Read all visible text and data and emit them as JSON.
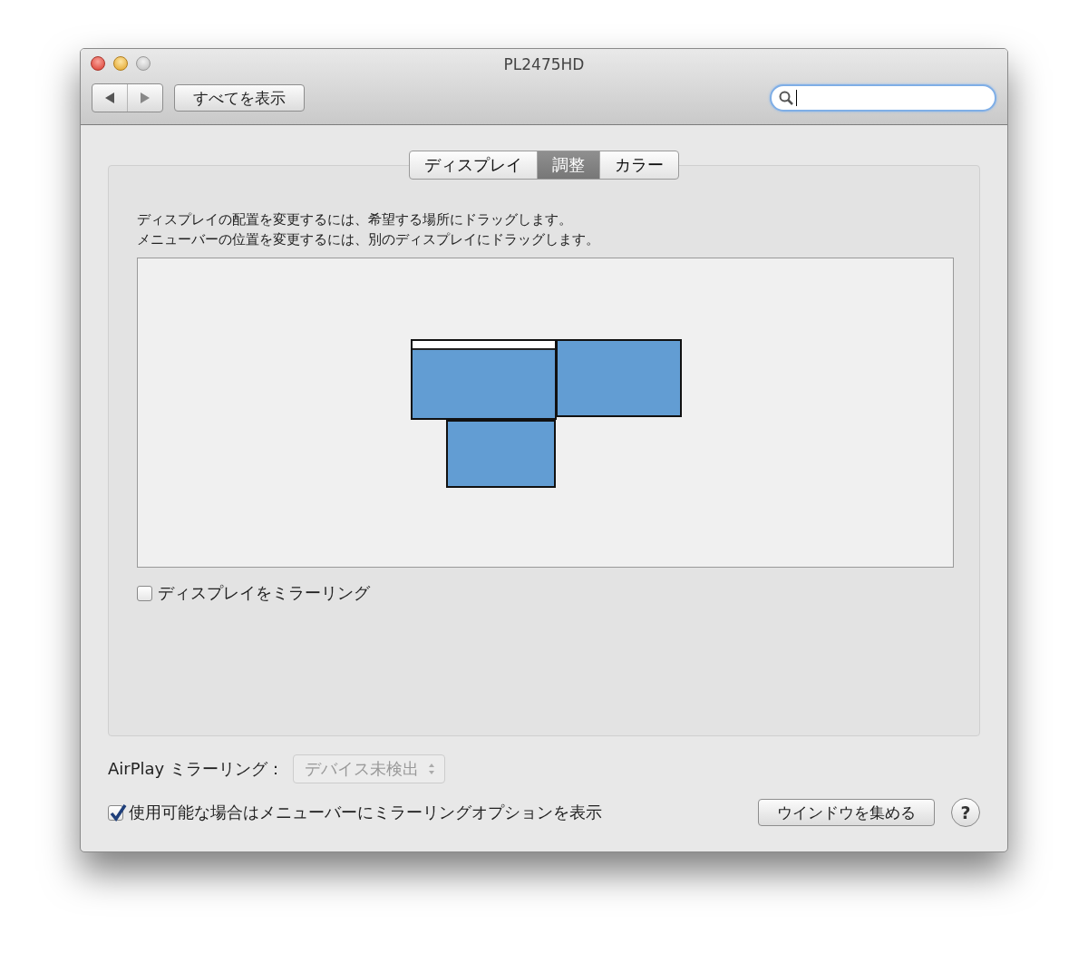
{
  "window": {
    "title": "PL2475HD"
  },
  "toolbar": {
    "show_all_button": "すべてを表示"
  },
  "tabs": [
    {
      "label": "ディスプレイ",
      "selected": false
    },
    {
      "label": "調整",
      "selected": true
    },
    {
      "label": "カラー",
      "selected": false
    }
  ],
  "instructions": [
    "ディスプレイの配置を変更するには、希望する場所にドラッグします。",
    "メニューバーの位置を変更するには、別のディスプレイにドラッグします。"
  ],
  "displays": [
    {
      "menu_bar": true
    },
    {
      "menu_bar": false
    },
    {
      "menu_bar": false
    }
  ],
  "mirror_checkbox": {
    "label": "ディスプレイをミラーリング",
    "checked": false
  },
  "airplay": {
    "label": "AirPlay ミラーリング：",
    "value": "デバイス未検出",
    "disabled": true
  },
  "menu_option_checkbox": {
    "label": "使用可能な場合はメニューバーにミラーリングオプションを表示",
    "checked": true
  },
  "gather_button": "ウインドウを集める",
  "help_button": "?"
}
